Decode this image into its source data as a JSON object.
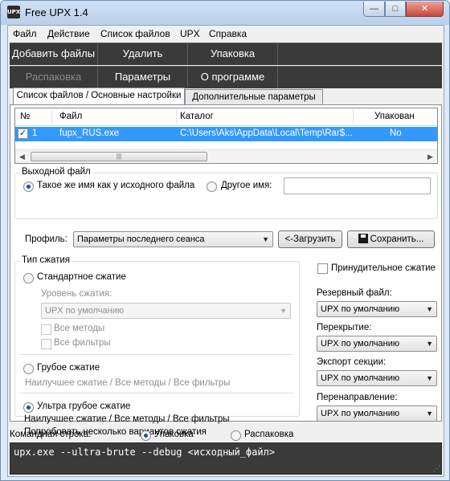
{
  "window": {
    "title": "Free UPX 1.4",
    "icon_text": "UPX",
    "minimize": "—",
    "maximize": "□",
    "close": "✕"
  },
  "menu": [
    "Файл",
    "Действие",
    "Список файлов",
    "UPX",
    "Справка"
  ],
  "toolbar": {
    "row1": [
      "Добавить файлы",
      "Удалить",
      "Упаковка"
    ],
    "row2": [
      "Распаковка",
      "Параметры",
      "О программе"
    ]
  },
  "tabs": [
    "Список файлов / Основные настройки",
    "Дополнительные параметры"
  ],
  "grid": {
    "columns": [
      "№",
      "Файл",
      "Каталог",
      "Упакован"
    ],
    "rows": [
      {
        "checked": true,
        "num": "1",
        "file": "fupx_RUS.exe",
        "dir": "C:\\Users\\Aks\\AppData\\Local\\Temp\\Rar$...",
        "packed": "No"
      }
    ]
  },
  "output": {
    "legend": "Выходной файл",
    "same_name": "Такое же имя как у исходного файла",
    "other_name": "Другое имя:",
    "other_name_value": "",
    "selected": "same_name"
  },
  "profile": {
    "label": "Профиль:",
    "selected": "Параметры последнего сеанса",
    "load_button": "<-Загрузить",
    "save_button": "Сохранить..."
  },
  "compression": {
    "legend": "Тип сжатия",
    "standard": "Стандартное сжатие",
    "level_label": "Уровень сжатия:",
    "level_value": "UPX по умолчанию",
    "all_methods": "Все методы",
    "all_filters": "Все фильтры",
    "brute": "Грубое сжатие",
    "brute_desc": "Наилучшее сжатие / Все методы / Все фильтры",
    "ultra": "Ультра грубое сжатие",
    "ultra_desc1": "Наилучшее сжатие / Все методы / Все фильтры",
    "ultra_desc2": "Попробовать несколько вариантов сжатия",
    "selected": "ultra"
  },
  "right": {
    "force": "Принудительное сжатие",
    "backup_label": "Резервный файл:",
    "backup_value": "UPX по умолчанию",
    "overlay_label": "Перекрытие:",
    "overlay_value": "UPX по умолчанию",
    "export_label": "Экспорт секции:",
    "export_value": "UPX по умолчанию",
    "redirect_label": "Перенаправление:",
    "redirect_value": "UPX по умолчанию"
  },
  "command": {
    "label": "Командная строка:",
    "pack": "Упаковка",
    "unpack": "Распаковка",
    "selected": "pack",
    "text": "upx.exe --ultra-brute --debug <исходный_файл>"
  }
}
